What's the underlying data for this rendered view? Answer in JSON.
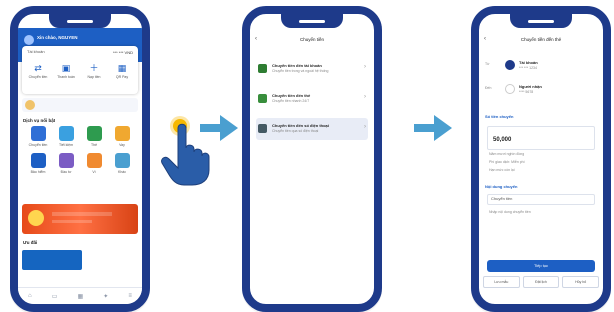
{
  "colors": {
    "phone_frame": "#1e3a8a",
    "primary_blue": "#1d5fc4",
    "arrow": "#4a9fd0",
    "tap_highlight": "#f6b800"
  },
  "phone1": {
    "user_name": "Xin chào, NGUYEN",
    "account_label": "Tài khoản",
    "balance": "*** *** VND",
    "quick_actions": [
      {
        "label": "Chuyển tiền",
        "icon": "transfer-icon"
      },
      {
        "label": "Thanh toán",
        "icon": "payment-icon"
      },
      {
        "label": "Nạp tiền",
        "icon": "topup-icon"
      },
      {
        "label": "QR Pay",
        "icon": "qr-icon"
      }
    ],
    "section_title": "Dịch vụ nổi bật",
    "services": [
      {
        "label": "Chuyển tiền",
        "color": "#2f6fd6"
      },
      {
        "label": "Tiết kiệm",
        "color": "#3aa0e0"
      },
      {
        "label": "Thẻ",
        "color": "#2e9b4f"
      },
      {
        "label": "Vay",
        "color": "#f0a830"
      },
      {
        "label": "Bảo hiểm",
        "color": "#1d5fc4"
      },
      {
        "label": "Đầu tư",
        "color": "#7b5cc4"
      },
      {
        "label": "Ví",
        "color": "#f08a30"
      },
      {
        "label": "Khác",
        "color": "#4a9fd0"
      }
    ],
    "promo_label": "Ưu đãi",
    "nav": [
      {
        "icon": "home-icon",
        "glyph": "⌂"
      },
      {
        "icon": "wallet-icon",
        "glyph": "▭"
      },
      {
        "icon": "qr-icon",
        "glyph": "▦"
      },
      {
        "icon": "gift-icon",
        "glyph": "✦"
      },
      {
        "icon": "menu-icon",
        "glyph": "≡"
      }
    ]
  },
  "phone2": {
    "back_glyph": "‹",
    "title": "Chuyển tiền",
    "items": [
      {
        "title": "Chuyển tiền đến tài khoản",
        "sub": "Chuyển tiền trong và ngoài hệ thống",
        "color": "#2e7d32"
      },
      {
        "title": "Chuyển tiền đến thẻ",
        "sub": "Chuyển tiền nhanh 24/7",
        "color": "#388e3c"
      },
      {
        "title": "Chuyển tiền đến số điện thoại",
        "sub": "Chuyển tiền qua số điện thoại",
        "color": "#455a64"
      }
    ]
  },
  "phone3": {
    "back_glyph": "‹",
    "title": "Chuyển tiền đến thẻ",
    "from_label": "Từ",
    "from_name": "Tài khoản",
    "from_sub": "*** *** 1234",
    "to_label": "Đến",
    "to_name": "Người nhận",
    "to_sub": "**** 5678",
    "section_info": "Số tiền chuyển",
    "amount": "50,000",
    "amount_line1": "Năm mươi nghìn đồng",
    "amount_line2": "Phí giao dịch: Miễn phí",
    "amount_line3": "Hạn mức còn lại",
    "section_content": "Nội dung chuyển",
    "content_line1": "Chuyển tiền",
    "content_line2": "Nhập nội dung chuyển tiền",
    "continue_label": "Tiếp tục",
    "footer_buttons": [
      "Lưu mẫu",
      "Đặt lịch",
      "Hủy bỏ"
    ]
  }
}
